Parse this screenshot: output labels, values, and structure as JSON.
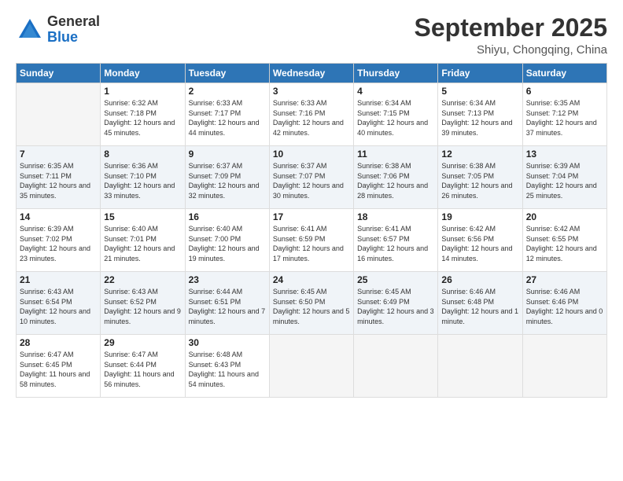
{
  "logo": {
    "general": "General",
    "blue": "Blue"
  },
  "header": {
    "month": "September 2025",
    "location": "Shiyu, Chongqing, China"
  },
  "days_of_week": [
    "Sunday",
    "Monday",
    "Tuesday",
    "Wednesday",
    "Thursday",
    "Friday",
    "Saturday"
  ],
  "weeks": [
    [
      {
        "day": "",
        "empty": true
      },
      {
        "day": "1",
        "sunrise": "Sunrise: 6:32 AM",
        "sunset": "Sunset: 7:18 PM",
        "daylight": "Daylight: 12 hours and 45 minutes."
      },
      {
        "day": "2",
        "sunrise": "Sunrise: 6:33 AM",
        "sunset": "Sunset: 7:17 PM",
        "daylight": "Daylight: 12 hours and 44 minutes."
      },
      {
        "day": "3",
        "sunrise": "Sunrise: 6:33 AM",
        "sunset": "Sunset: 7:16 PM",
        "daylight": "Daylight: 12 hours and 42 minutes."
      },
      {
        "day": "4",
        "sunrise": "Sunrise: 6:34 AM",
        "sunset": "Sunset: 7:15 PM",
        "daylight": "Daylight: 12 hours and 40 minutes."
      },
      {
        "day": "5",
        "sunrise": "Sunrise: 6:34 AM",
        "sunset": "Sunset: 7:13 PM",
        "daylight": "Daylight: 12 hours and 39 minutes."
      },
      {
        "day": "6",
        "sunrise": "Sunrise: 6:35 AM",
        "sunset": "Sunset: 7:12 PM",
        "daylight": "Daylight: 12 hours and 37 minutes."
      }
    ],
    [
      {
        "day": "7",
        "sunrise": "Sunrise: 6:35 AM",
        "sunset": "Sunset: 7:11 PM",
        "daylight": "Daylight: 12 hours and 35 minutes."
      },
      {
        "day": "8",
        "sunrise": "Sunrise: 6:36 AM",
        "sunset": "Sunset: 7:10 PM",
        "daylight": "Daylight: 12 hours and 33 minutes."
      },
      {
        "day": "9",
        "sunrise": "Sunrise: 6:37 AM",
        "sunset": "Sunset: 7:09 PM",
        "daylight": "Daylight: 12 hours and 32 minutes."
      },
      {
        "day": "10",
        "sunrise": "Sunrise: 6:37 AM",
        "sunset": "Sunset: 7:07 PM",
        "daylight": "Daylight: 12 hours and 30 minutes."
      },
      {
        "day": "11",
        "sunrise": "Sunrise: 6:38 AM",
        "sunset": "Sunset: 7:06 PM",
        "daylight": "Daylight: 12 hours and 28 minutes."
      },
      {
        "day": "12",
        "sunrise": "Sunrise: 6:38 AM",
        "sunset": "Sunset: 7:05 PM",
        "daylight": "Daylight: 12 hours and 26 minutes."
      },
      {
        "day": "13",
        "sunrise": "Sunrise: 6:39 AM",
        "sunset": "Sunset: 7:04 PM",
        "daylight": "Daylight: 12 hours and 25 minutes."
      }
    ],
    [
      {
        "day": "14",
        "sunrise": "Sunrise: 6:39 AM",
        "sunset": "Sunset: 7:02 PM",
        "daylight": "Daylight: 12 hours and 23 minutes."
      },
      {
        "day": "15",
        "sunrise": "Sunrise: 6:40 AM",
        "sunset": "Sunset: 7:01 PM",
        "daylight": "Daylight: 12 hours and 21 minutes."
      },
      {
        "day": "16",
        "sunrise": "Sunrise: 6:40 AM",
        "sunset": "Sunset: 7:00 PM",
        "daylight": "Daylight: 12 hours and 19 minutes."
      },
      {
        "day": "17",
        "sunrise": "Sunrise: 6:41 AM",
        "sunset": "Sunset: 6:59 PM",
        "daylight": "Daylight: 12 hours and 17 minutes."
      },
      {
        "day": "18",
        "sunrise": "Sunrise: 6:41 AM",
        "sunset": "Sunset: 6:57 PM",
        "daylight": "Daylight: 12 hours and 16 minutes."
      },
      {
        "day": "19",
        "sunrise": "Sunrise: 6:42 AM",
        "sunset": "Sunset: 6:56 PM",
        "daylight": "Daylight: 12 hours and 14 minutes."
      },
      {
        "day": "20",
        "sunrise": "Sunrise: 6:42 AM",
        "sunset": "Sunset: 6:55 PM",
        "daylight": "Daylight: 12 hours and 12 minutes."
      }
    ],
    [
      {
        "day": "21",
        "sunrise": "Sunrise: 6:43 AM",
        "sunset": "Sunset: 6:54 PM",
        "daylight": "Daylight: 12 hours and 10 minutes."
      },
      {
        "day": "22",
        "sunrise": "Sunrise: 6:43 AM",
        "sunset": "Sunset: 6:52 PM",
        "daylight": "Daylight: 12 hours and 9 minutes."
      },
      {
        "day": "23",
        "sunrise": "Sunrise: 6:44 AM",
        "sunset": "Sunset: 6:51 PM",
        "daylight": "Daylight: 12 hours and 7 minutes."
      },
      {
        "day": "24",
        "sunrise": "Sunrise: 6:45 AM",
        "sunset": "Sunset: 6:50 PM",
        "daylight": "Daylight: 12 hours and 5 minutes."
      },
      {
        "day": "25",
        "sunrise": "Sunrise: 6:45 AM",
        "sunset": "Sunset: 6:49 PM",
        "daylight": "Daylight: 12 hours and 3 minutes."
      },
      {
        "day": "26",
        "sunrise": "Sunrise: 6:46 AM",
        "sunset": "Sunset: 6:48 PM",
        "daylight": "Daylight: 12 hours and 1 minute."
      },
      {
        "day": "27",
        "sunrise": "Sunrise: 6:46 AM",
        "sunset": "Sunset: 6:46 PM",
        "daylight": "Daylight: 12 hours and 0 minutes."
      }
    ],
    [
      {
        "day": "28",
        "sunrise": "Sunrise: 6:47 AM",
        "sunset": "Sunset: 6:45 PM",
        "daylight": "Daylight: 11 hours and 58 minutes."
      },
      {
        "day": "29",
        "sunrise": "Sunrise: 6:47 AM",
        "sunset": "Sunset: 6:44 PM",
        "daylight": "Daylight: 11 hours and 56 minutes."
      },
      {
        "day": "30",
        "sunrise": "Sunrise: 6:48 AM",
        "sunset": "Sunset: 6:43 PM",
        "daylight": "Daylight: 11 hours and 54 minutes."
      },
      {
        "day": "",
        "empty": true
      },
      {
        "day": "",
        "empty": true
      },
      {
        "day": "",
        "empty": true
      },
      {
        "day": "",
        "empty": true
      }
    ]
  ]
}
